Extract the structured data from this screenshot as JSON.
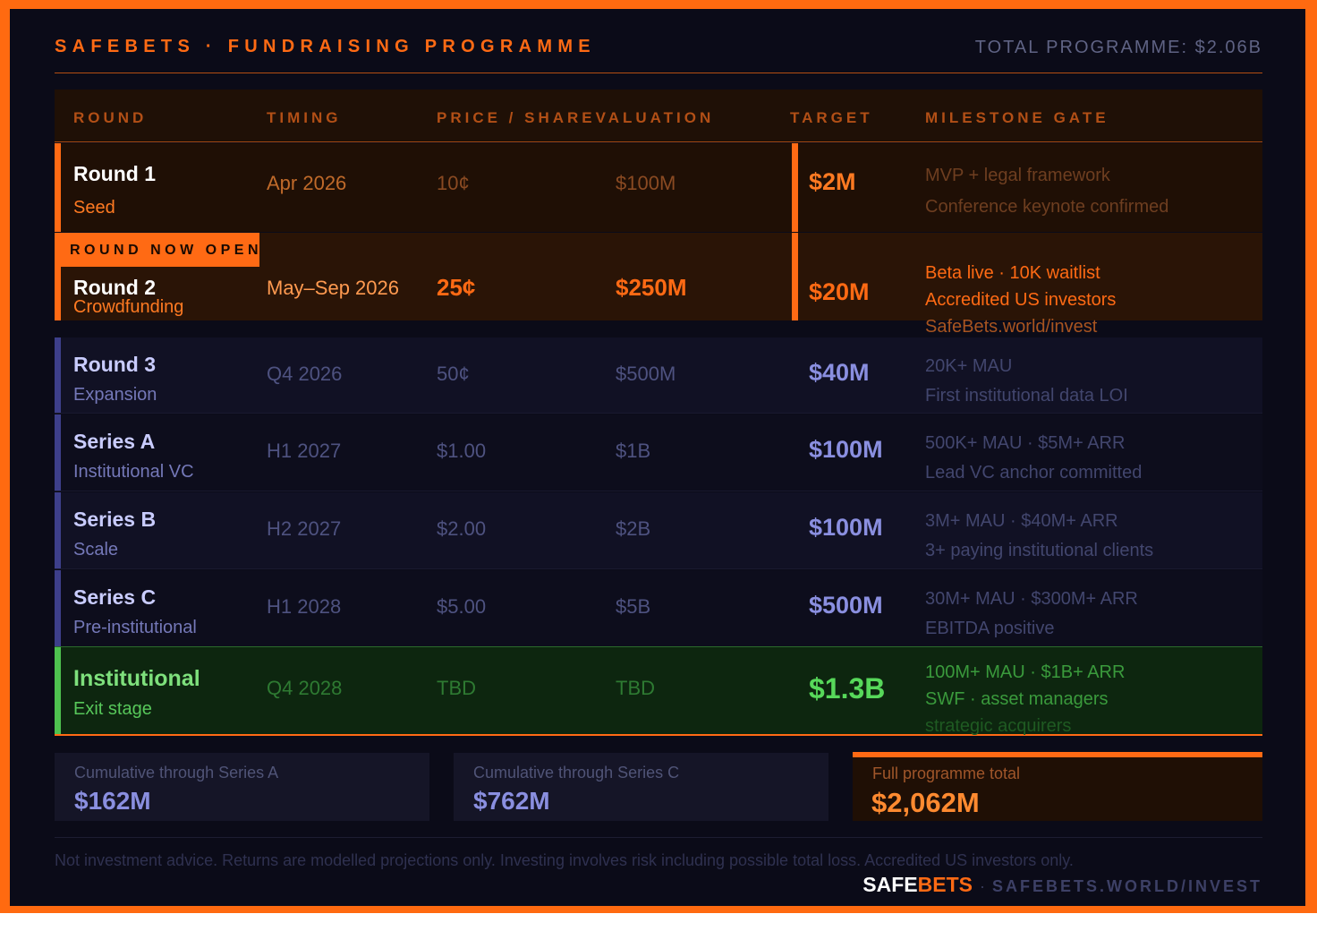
{
  "header": {
    "title": "SAFEBETS · FUNDRAISING PROGRAMME",
    "total": "TOTAL PROGRAMME: $2.06B"
  },
  "columns": {
    "round": "ROUND",
    "timing": "TIMING",
    "price_valuation": "PRICE / SHAREVALUATION",
    "target": "TARGET",
    "milestone": "MILESTONE GATE"
  },
  "badge": "ROUND NOW OPEN",
  "rounds": [
    {
      "name": "Round 1",
      "subtitle": "Seed",
      "timing": "Apr 2026",
      "price": "10¢",
      "valuation": "$100M",
      "target": "$2M",
      "milestones": [
        "MVP + legal framework",
        "Conference keynote confirmed"
      ]
    },
    {
      "name": "Round 2",
      "subtitle": "Crowdfunding",
      "timing": "May–Sep 2026",
      "price": "25¢",
      "valuation": "$250M",
      "target": "$20M",
      "milestones": [
        "Beta live · 10K waitlist",
        "Accredited US investors",
        "SafeBets.world/invest"
      ]
    },
    {
      "name": "Round 3",
      "subtitle": "Expansion",
      "timing": "Q4 2026",
      "price": "50¢",
      "valuation": "$500M",
      "target": "$40M",
      "milestones": [
        "20K+ MAU",
        "First institutional data LOI"
      ]
    },
    {
      "name": "Series A",
      "subtitle": "Institutional VC",
      "timing": "H1 2027",
      "price": "$1.00",
      "valuation": "$1B",
      "target": "$100M",
      "milestones": [
        "500K+ MAU · $5M+ ARR",
        "Lead VC anchor committed"
      ]
    },
    {
      "name": "Series B",
      "subtitle": "Scale",
      "timing": "H2 2027",
      "price": "$2.00",
      "valuation": "$2B",
      "target": "$100M",
      "milestones": [
        "3M+ MAU · $40M+ ARR",
        "3+ paying institutional clients"
      ]
    },
    {
      "name": "Series C",
      "subtitle": "Pre-institutional",
      "timing": "H1 2028",
      "price": "$5.00",
      "valuation": "$5B",
      "target": "$500M",
      "milestones": [
        "30M+ MAU · $300M+ ARR",
        "EBITDA positive"
      ]
    },
    {
      "name": "Institutional",
      "subtitle": "Exit stage",
      "timing": "Q4 2028",
      "price": "TBD",
      "valuation": "TBD",
      "target": "$1.3B",
      "milestones": [
        "100M+ MAU · $1B+ ARR",
        "SWF · asset managers",
        "strategic acquirers"
      ]
    }
  ],
  "summary": [
    {
      "label": "Cumulative through Series A",
      "amount": "$162M"
    },
    {
      "label": "Cumulative through Series C",
      "amount": "$762M"
    },
    {
      "label": "Full programme total",
      "amount": "$2,062M"
    }
  ],
  "footer": {
    "disclaimer": "Not investment advice. Returns are modelled projections only. Investing involves risk including possible total loss. Accredited US investors only.",
    "brand_a": "SAFE",
    "brand_b": "BETS",
    "separator": "·",
    "url": "SAFEBETS.WORLD/INVEST"
  },
  "colors": {
    "accent_orange": "#ff6a14",
    "indigo": "#8a8fe0",
    "green": "#57c75a"
  }
}
